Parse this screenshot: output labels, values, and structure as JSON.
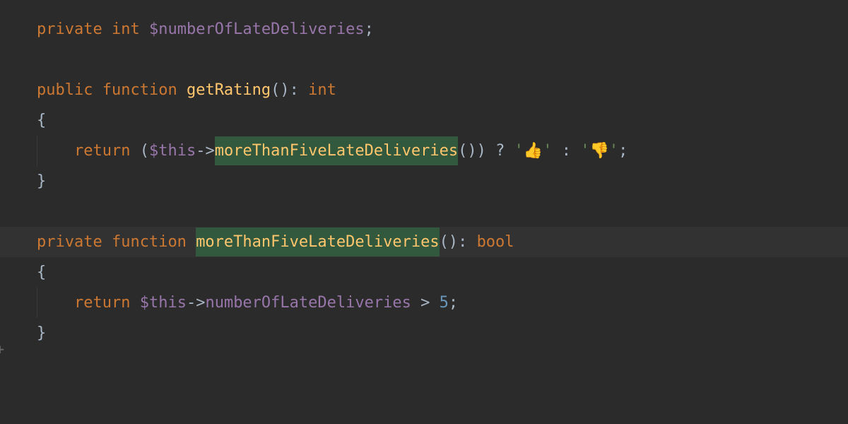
{
  "code": {
    "line1": {
      "kw1": "private",
      "type": "int",
      "var": "$numberOfLateDeliveries",
      "semi": ";"
    },
    "line3": {
      "kw1": "public",
      "kw2": "function",
      "fn": "getRating",
      "parens": "()",
      "colon": ":",
      "ret": "int"
    },
    "line4": {
      "brace": "{"
    },
    "line5": {
      "kw": "return",
      "open": " (",
      "this": "$this",
      "arrow": "->",
      "call": "moreThanFiveLateDeliveries",
      "callp": "()",
      "close": ")",
      "tern1": " ? ",
      "q1": "'",
      "emo1": "👍",
      "q2": "'",
      "tern2": " : ",
      "q3": "'",
      "emo2": "👎",
      "q4": "'",
      "semi": ";"
    },
    "line6": {
      "brace": "}"
    },
    "line8": {
      "kw1": "private",
      "kw2": "function",
      "fn": "moreThanFiveLateDeliveries",
      "parens": "()",
      "colon": ":",
      "ret": "bool"
    },
    "line9": {
      "brace": "{"
    },
    "line10": {
      "kw": "return",
      "this": " $this",
      "arrow": "->",
      "prop": "numberOfLateDeliveries",
      "op": " > ",
      "num": "5",
      "semi": ";"
    },
    "line11": {
      "brace": "}"
    }
  },
  "gutter": {
    "add": "+"
  }
}
